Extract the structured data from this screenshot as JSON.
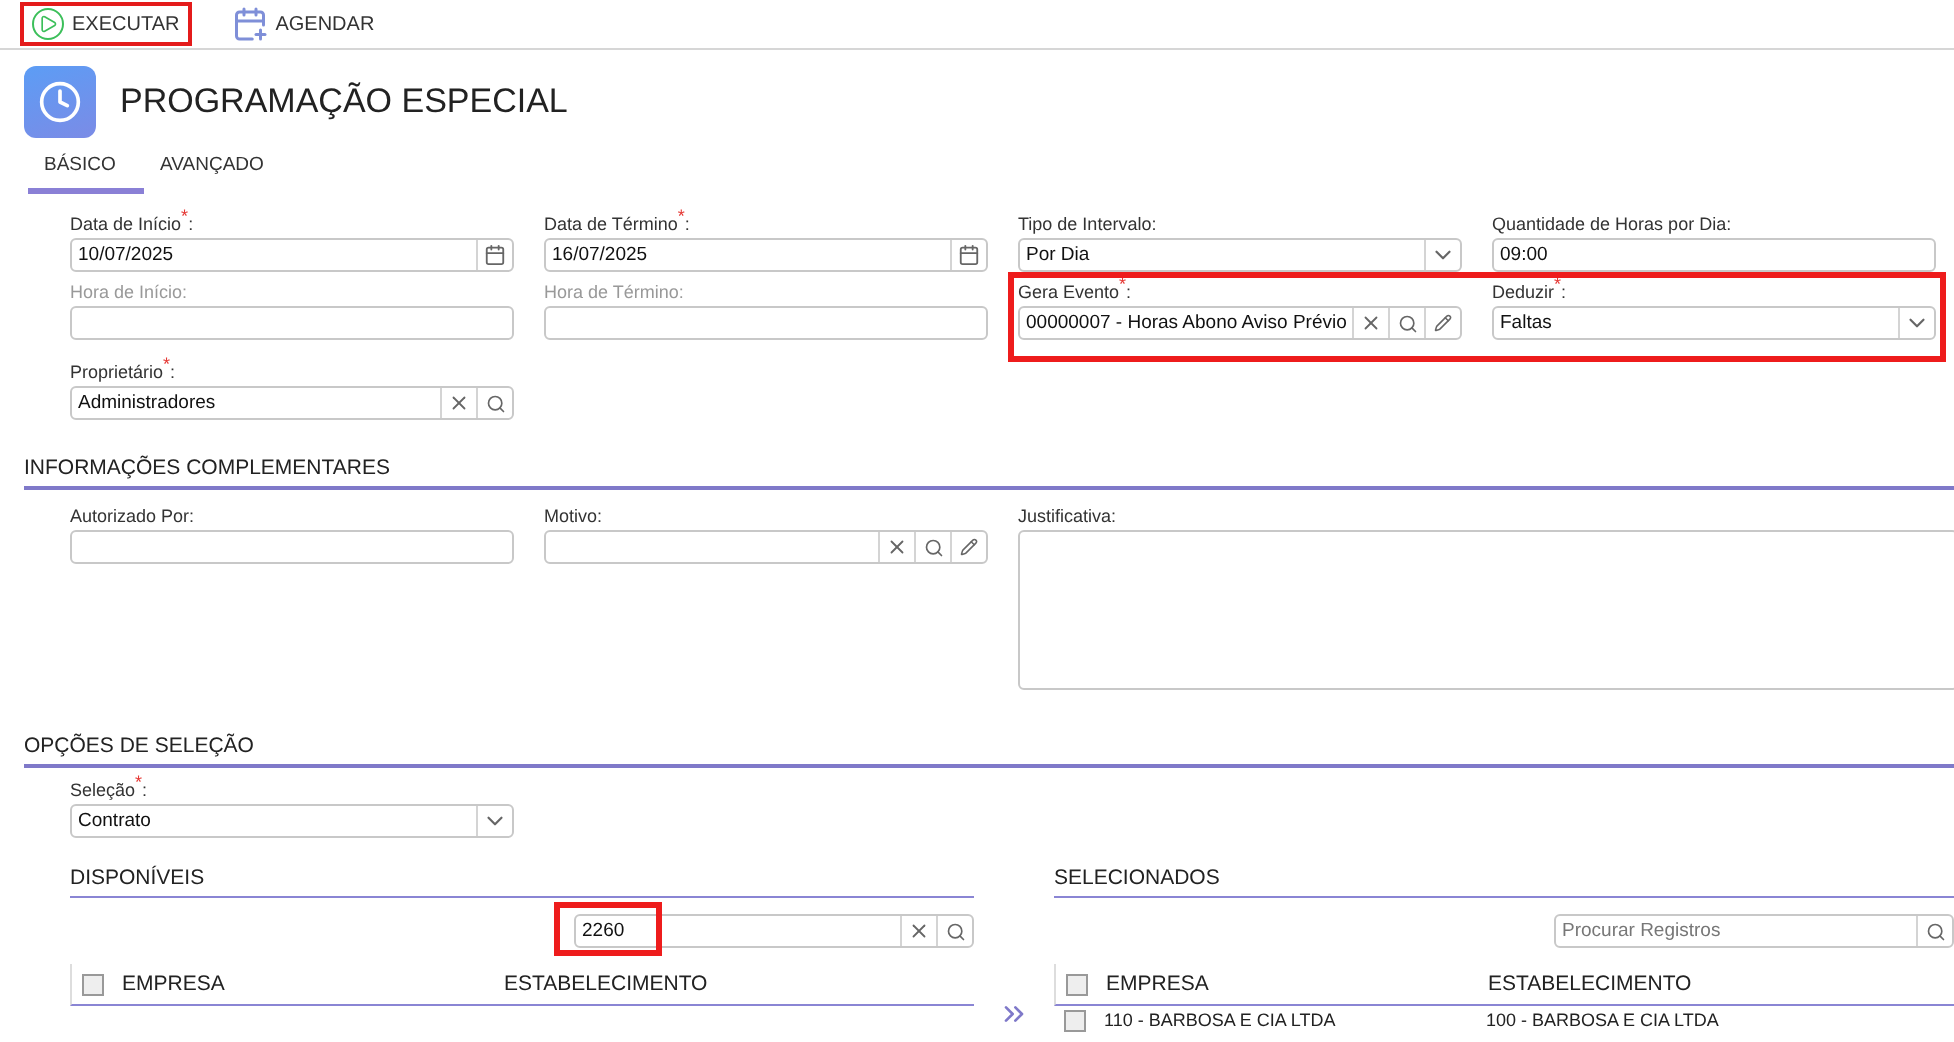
{
  "toolbar": [
    {
      "kind": "run",
      "label": "EXECUTAR",
      "highlighted": true
    },
    {
      "kind": "schedule",
      "label": "AGENDAR",
      "highlighted": false
    }
  ],
  "title": "PROGRAMAÇÃO ESPECIAL",
  "tabs": [
    {
      "label": "BÁSICO",
      "selected": true
    },
    {
      "label": "AVANÇADO",
      "selected": false
    }
  ],
  "basic": {
    "rows": [
      {
        "fields": [
          {
            "kind": "date",
            "label": "Data de Início$^{*}$:",
            "value": "10/07/2025",
            "disabled": false,
            "highlighted": false
          },
          {
            "kind": "date",
            "label": "Data de Término$^{*}$:",
            "value": "16/07/2025",
            "disabled": false,
            "highlighted": false
          },
          {
            "kind": "select",
            "label": "Tipo de Intervalo:",
            "value": "Por Dia",
            "disabled": false,
            "highlighted": false
          },
          {
            "kind": "text",
            "label": "Quantidade de Horas por Dia:",
            "value": "09:00",
            "disabled": false,
            "highlighted": false
          }
        ]
      },
      {
        "fields": [
          {
            "kind": "text",
            "label": "Hora de Início:",
            "disabled": true,
            "highlighted": false
          },
          {
            "kind": "text",
            "label": "Hora de Término:",
            "disabled": true,
            "highlighted": false
          },
          {
            "kind": "lookup_edit",
            "label": "Gera Evento$^{*}$:",
            "value": "00000007 - Horas Abono Aviso Prévio",
            "disabled": false,
            "highlighted": true
          },
          {
            "kind": "select",
            "label": "Deduzir$^{*}$:",
            "value": "Faltas",
            "disabled": false,
            "highlighted": true
          }
        ]
      },
      {
        "fields": [
          {
            "kind": "lookup",
            "label": "Proprietário$^{*}$:",
            "value": "Administradores",
            "disabled": false,
            "highlighted": false
          }
        ]
      }
    ]
  },
  "complementary": {
    "heading": "INFORMAÇÕES COMPLEMENTARES",
    "fields": [
      {
        "kind": "text",
        "label": "Autorizado Por:"
      },
      {
        "kind": "lookup_edit",
        "label": "Motivo:"
      },
      {
        "kind": "textarea",
        "label": "Justificativa:"
      }
    ]
  },
  "selection": {
    "heading": "OPÇÕES DE SELEÇÃO",
    "field": {
      "kind": "select",
      "label": "Seleção$^{*}$:",
      "value": "Contrato"
    },
    "lists": [
      {
        "heading": "DISPONÍVEIS",
        "search": {
          "value": "2260",
          "clearable": true,
          "highlighted": true
        },
        "all_checked": false,
        "columns": [
          "EMPRESA",
          "ESTABELECIMENTO"
        ]
      },
      {
        "heading": "SELECIONADOS",
        "search": {
          "placeholder": "Procurar Registros",
          "clearable": false,
          "highlighted": false
        },
        "all_checked": false,
        "columns": [
          "EMPRESA",
          "ESTABELECIMENTO"
        ],
        "rows": [
          {
            "checked": false,
            "cells": [
              "110 - BARBOSA E CIA LTDA",
              "100 - BARBOSA E CIA LTDA"
            ]
          }
        ]
      }
    ]
  }
}
